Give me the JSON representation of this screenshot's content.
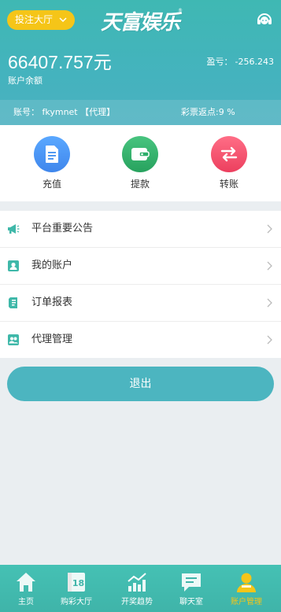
{
  "header": {
    "lobby_label": "投注大厅",
    "logo_text": "天富娱乐",
    "logo_mark": "®",
    "service_icon": "headset-icon"
  },
  "account": {
    "balance": "66407.757元",
    "balance_label": "账户余额",
    "profit_label": "盈亏：",
    "profit_value": "-256.243",
    "account_line": "账号： fkymnet 【代理】",
    "rebate_line": "彩票返点:9 %"
  },
  "quick_actions": [
    {
      "label": "充值",
      "icon": "document-icon",
      "color": "#3f8ff0"
    },
    {
      "label": "提款",
      "icon": "wallet-icon",
      "color": "#2dae6a"
    },
    {
      "label": "转账",
      "icon": "transfer-icon",
      "color": "#f2506c"
    }
  ],
  "menu": [
    {
      "label": "平台重要公告",
      "icon": "megaphone-icon"
    },
    {
      "label": "我的账户",
      "icon": "user-card-icon"
    },
    {
      "label": "订单报表",
      "icon": "report-icon"
    },
    {
      "label": "代理管理",
      "icon": "team-icon"
    }
  ],
  "logout_label": "退出",
  "tabs": [
    {
      "label": "主页",
      "icon": "home-icon"
    },
    {
      "label": "购彩大厅",
      "icon": "lottery-icon",
      "badge": "18"
    },
    {
      "label": "开奖趋势",
      "icon": "trend-chart-icon"
    },
    {
      "label": "聊天室",
      "icon": "chat-icon"
    },
    {
      "label": "账户管理",
      "icon": "user-icon",
      "active": true
    }
  ],
  "colors": {
    "accent": "#44b3be",
    "tab_active": "#f5c518",
    "lobby_button": "#f5c518"
  }
}
